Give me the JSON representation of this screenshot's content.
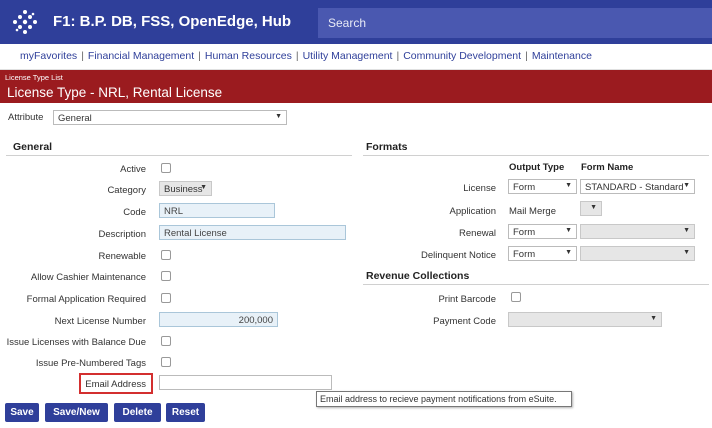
{
  "header": {
    "app_title": "F1: B.P. DB, FSS, OpenEdge, Hub",
    "search_placeholder": "Search",
    "logo_icon": "diamond-dots-logo-icon",
    "bg_color": "#2f3f9a"
  },
  "nav": {
    "items": [
      "myFavorites",
      "Financial Management",
      "Human Resources",
      "Utility Management",
      "Community Development",
      "Maintenance"
    ],
    "separator": "|"
  },
  "title_bar": {
    "breadcrumb": "License Type List",
    "title": "License Type - NRL, Rental License",
    "bg_color": "#9b1b1f"
  },
  "attribute": {
    "label": "Attribute",
    "value": "General"
  },
  "general": {
    "heading": "General",
    "active_label": "Active",
    "category_label": "Category",
    "category_value": "Business",
    "code_label": "Code",
    "code_value": "NRL",
    "description_label": "Description",
    "description_value": "Rental License",
    "renewable_label": "Renewable",
    "allow_cashier_label": "Allow Cashier Maintenance",
    "formal_app_label": "Formal Application Required",
    "next_license_label": "Next License Number",
    "next_license_value": "200,000",
    "issue_balance_label": "Issue Licenses with Balance Due",
    "issue_tags_label": "Issue Pre-Numbered Tags",
    "email_label": "Email Address",
    "email_value": ""
  },
  "formats": {
    "heading": "Formats",
    "output_type_header": "Output Type",
    "form_name_header": "Form Name",
    "license_label": "License",
    "license_output": "Form",
    "license_form_name": "STANDARD - Standard",
    "application_label": "Application",
    "application_output": "Mail Merge",
    "renewal_label": "Renewal",
    "renewal_output": "Form",
    "delinquent_label": "Delinquent Notice",
    "delinquent_output": "Form"
  },
  "revenue": {
    "heading": "Revenue Collections",
    "print_barcode_label": "Print Barcode",
    "payment_code_label": "Payment Code"
  },
  "tooltip": {
    "text": "Email address to recieve payment notifications from eSuite."
  },
  "buttons": {
    "save": "Save",
    "save_new": "Save/New",
    "delete": "Delete",
    "reset": "Reset"
  }
}
